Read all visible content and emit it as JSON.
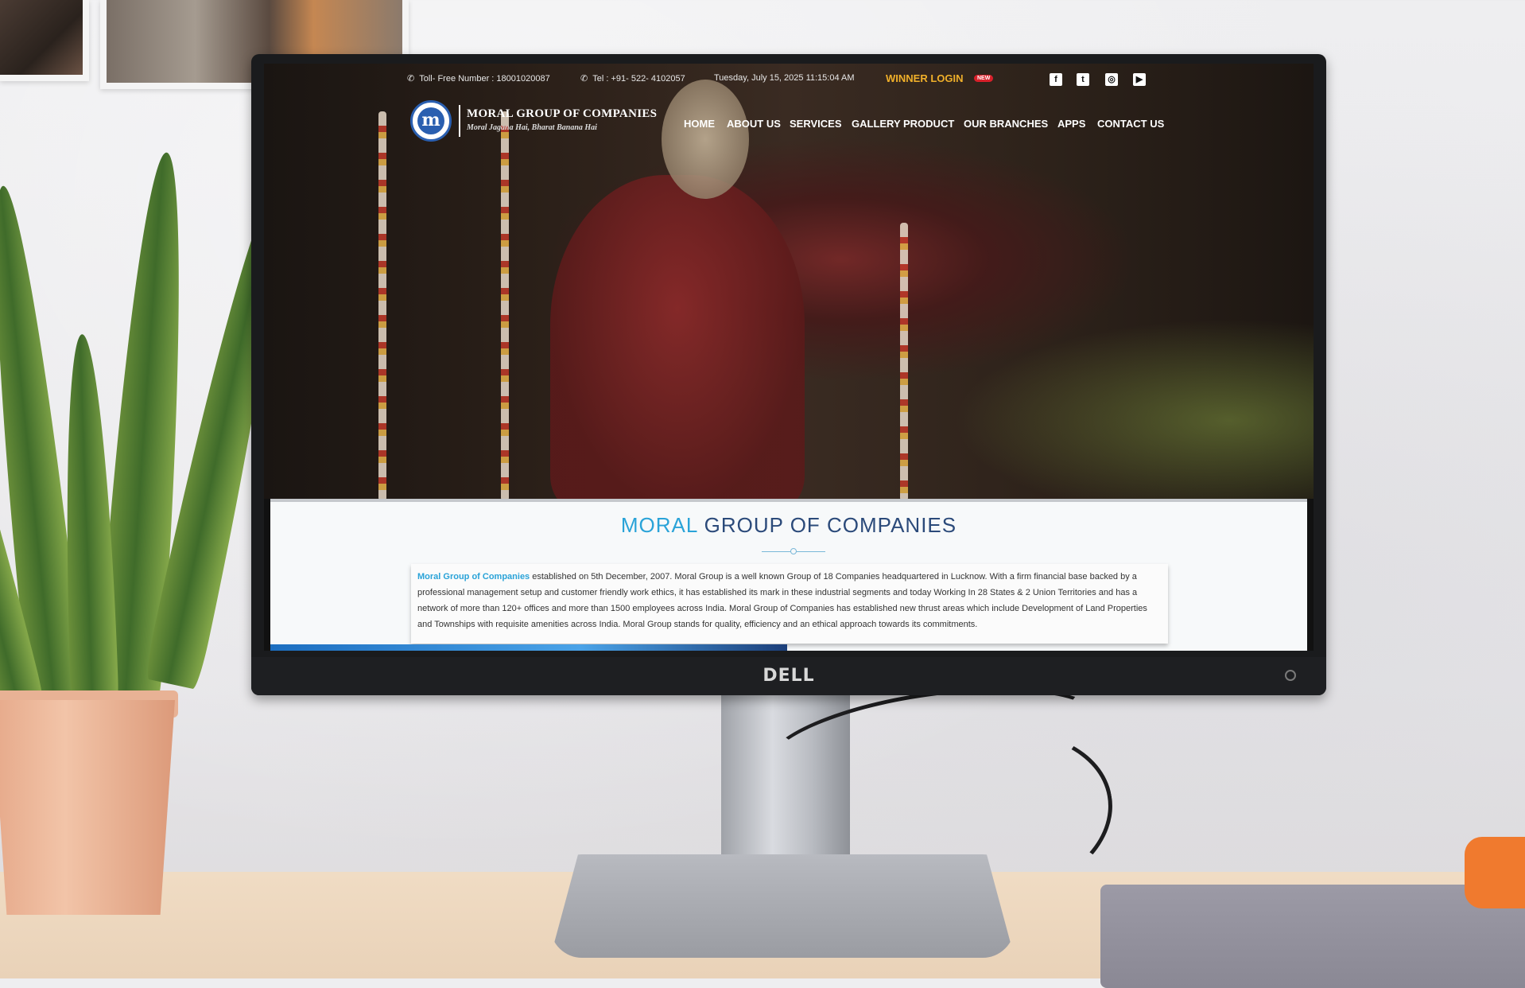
{
  "topbar": {
    "toll_free": "Toll- Free Number : 18001020087",
    "tel": "Tel : +91- 522- 4102057",
    "datetime": "Tuesday, July 15, 2025 11:15:04 AM",
    "winner_login": "WINNER LOGIN",
    "new_badge": "NEW",
    "social": [
      "facebook-icon",
      "twitter-icon",
      "instagram-icon",
      "youtube-icon"
    ]
  },
  "logo": {
    "mark": "m",
    "name": "MORAL GROUP OF COMPANIES",
    "tagline": "Moral Jagana Hai, Bharat Banana Hai"
  },
  "nav": [
    "HOME",
    "ABOUT US",
    "SERVICES",
    "GALLERY",
    "PRODUCT",
    "OUR BRANCHES",
    "APPS",
    "CONTACT US"
  ],
  "content": {
    "heading_accent": "MORAL",
    "heading_rest": "GROUP OF COMPANIES",
    "about_link": "Moral Group of Companies",
    "about_text": "established on 5th December, 2007. Moral Group is a well known Group of 18 Companies headquartered in Lucknow. With a firm financial base backed by a professional management setup and customer friendly work ethics, it has established its mark in these industrial segments and today Working In 28 States & 2 Union Territories and has a network of more than 120+ offices and more than 1500 employees across India. Moral Group of Companies has established new thrust areas which include Development of Land Properties and Townships with requisite amenities across India. Moral Group stands for quality, efficiency and an ethical approach towards its commitments."
  },
  "monitor": {
    "brand": "DELL"
  },
  "colors": {
    "accent_blue": "#2aa3d8",
    "navy": "#2b4a7a",
    "gold": "#f0b02a",
    "badge_red": "#d8202a"
  }
}
